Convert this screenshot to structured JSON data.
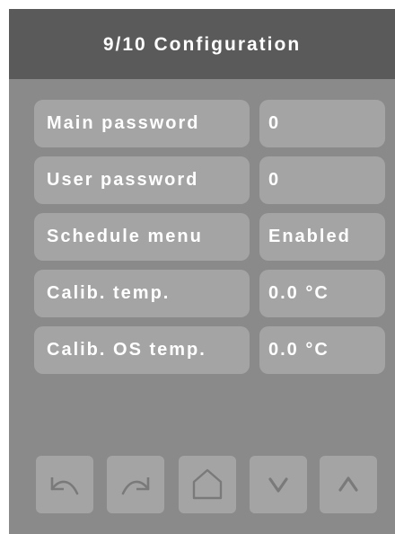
{
  "header": {
    "title": "9/10 Configuration"
  },
  "settings": [
    {
      "label": "Main password",
      "value": "0"
    },
    {
      "label": "User password",
      "value": "0"
    },
    {
      "label": "Schedule menu",
      "value": "Enabled"
    },
    {
      "label": "Calib. temp.",
      "value": "0.0 °C"
    },
    {
      "label": "Calib. OS temp.",
      "value": "0.0 °C"
    }
  ],
  "nav": {
    "icons": [
      "undo-arrow-icon",
      "redo-arrow-icon",
      "home-icon",
      "chevron-down-icon",
      "chevron-up-icon"
    ]
  },
  "colors": {
    "screen_background": "#8a8a8a",
    "title_bar": "#5a5a5a",
    "field_background": "#a4a4a4",
    "text": "#ffffff",
    "icon_stroke": "#7a7a7a"
  }
}
